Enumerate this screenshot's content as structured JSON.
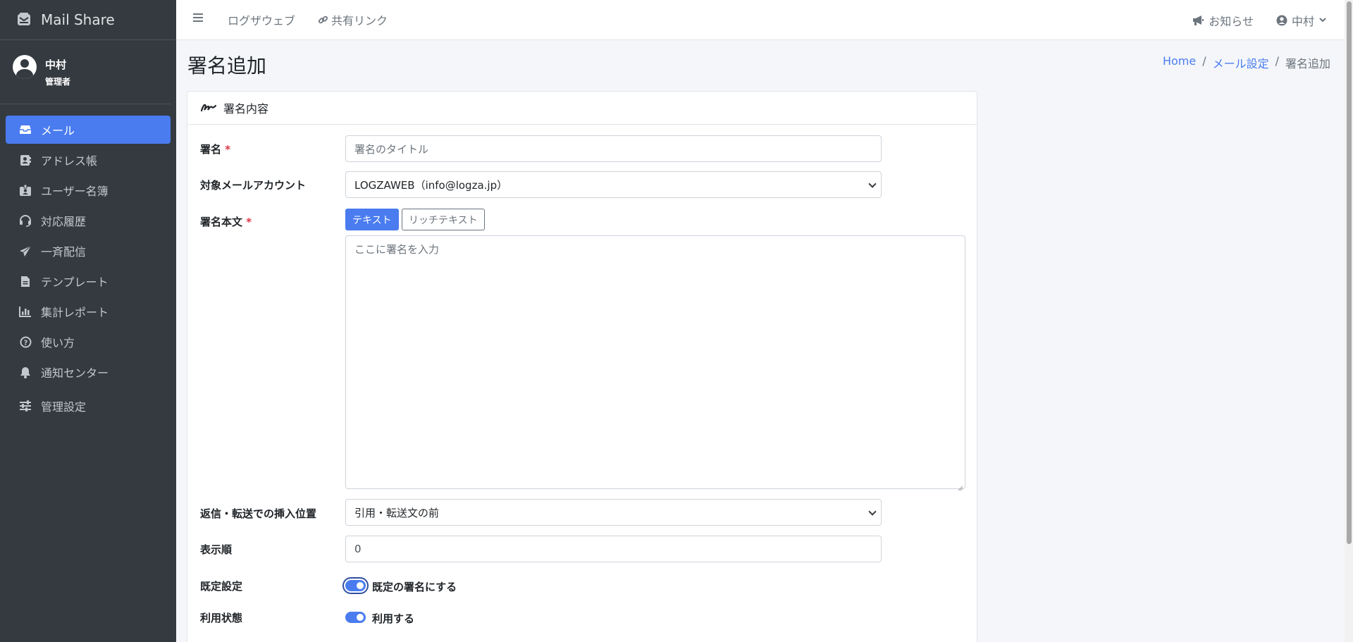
{
  "brand": {
    "name": "Mail Share",
    "icon": "mail-share-logo-icon"
  },
  "user": {
    "name": "中村",
    "role": "管理者"
  },
  "sidebar": {
    "items": [
      {
        "label": "メール",
        "icon": "inbox-icon",
        "active": true
      },
      {
        "label": "アドレス帳",
        "icon": "address-book-icon"
      },
      {
        "label": "ユーザー名簿",
        "icon": "id-badge-icon"
      },
      {
        "label": "対応履歴",
        "icon": "headset-icon"
      },
      {
        "label": "一斉配信",
        "icon": "paper-plane-icon"
      },
      {
        "label": "テンプレート",
        "icon": "file-text-icon"
      },
      {
        "label": "集計レポート",
        "icon": "bar-chart-icon"
      },
      {
        "label": "使い方",
        "icon": "question-circle-icon"
      },
      {
        "label": "通知センター",
        "icon": "bell-icon"
      },
      {
        "label": "管理設定",
        "icon": "sliders-icon"
      }
    ]
  },
  "topbar": {
    "link1": "ログザウェブ",
    "link2": "共有リンク",
    "notifications": "お知らせ",
    "user": "中村"
  },
  "page": {
    "title": "署名追加",
    "breadcrumb": {
      "home": "Home",
      "sep": "/",
      "parent": "メール設定",
      "current": "署名追加"
    }
  },
  "card": {
    "header": "署名内容",
    "required_mark": "*",
    "fields": {
      "signature_label": "署名",
      "signature_placeholder": "署名のタイトル",
      "account_label": "対象メールアカウント",
      "account_value": "LOGZAWEB（info@logza.jp）",
      "body_label": "署名本文",
      "tab_text": "テキスト",
      "tab_rich": "リッチテキスト",
      "body_placeholder": "ここに署名を入力",
      "position_label": "返信・転送での挿入位置",
      "position_value": "引用・転送文の前",
      "order_label": "表示順",
      "order_value": "0",
      "default_label": "既定設定",
      "default_switch": "既定の署名にする",
      "status_label": "利用状態",
      "status_switch": "利用する"
    }
  },
  "colors": {
    "sidebar_bg": "#343a40",
    "accent": "#4a7cf0",
    "required": "#dc3545"
  }
}
